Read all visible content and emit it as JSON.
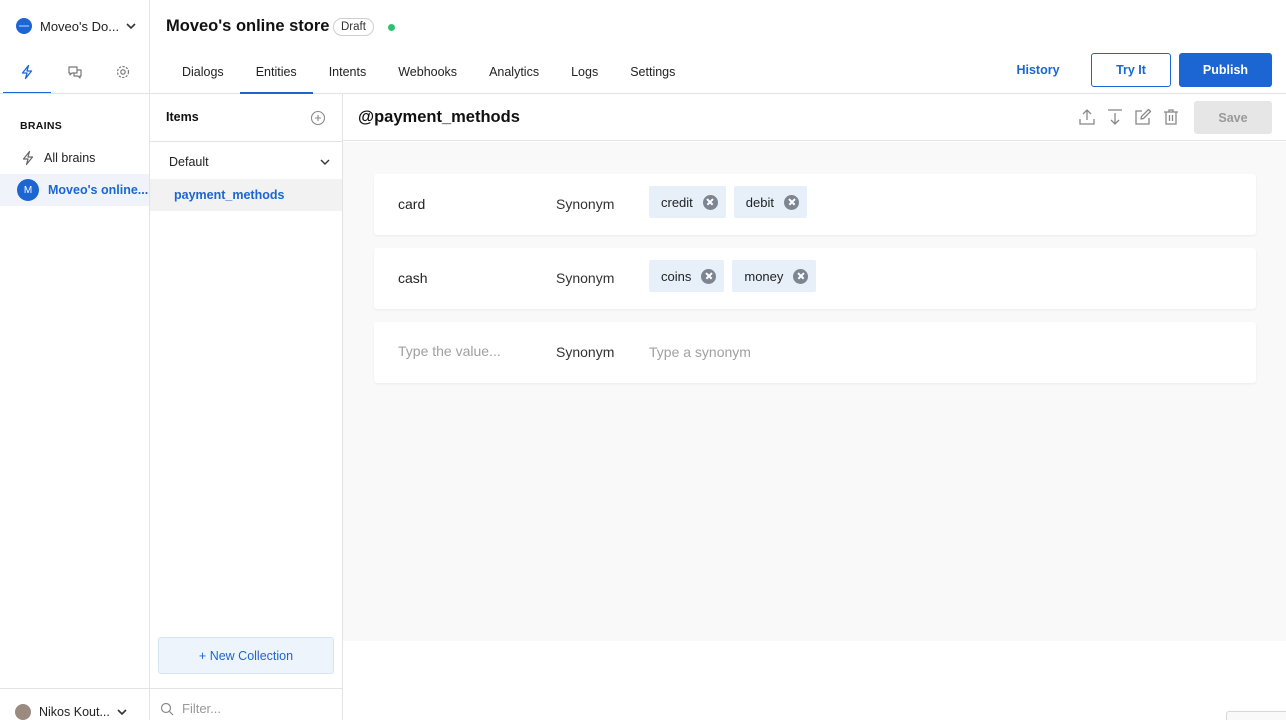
{
  "workspace": {
    "name": "Moveo's Do..."
  },
  "sidebar": {
    "tabs": [
      {
        "icon": "lightning-icon",
        "active": true
      },
      {
        "icon": "chat-bubbles-icon",
        "active": false
      },
      {
        "icon": "gear-icon",
        "active": false
      }
    ],
    "section_title": "BRAINS",
    "all_brains_label": "All brains",
    "active_brain": {
      "avatar_letter": "M",
      "label": "Moveo's online..."
    },
    "user_name": "Nikos Kout..."
  },
  "header": {
    "title": "Moveo's online store",
    "status_badge": "Draft",
    "status_color": "#2fc26e",
    "nav": [
      "Dialogs",
      "Entities",
      "Intents",
      "Webhooks",
      "Analytics",
      "Logs",
      "Settings"
    ],
    "active_nav": "Entities",
    "history_label": "History",
    "try_it_label": "Try It",
    "publish_label": "Publish"
  },
  "items_panel": {
    "title": "Items",
    "collection_name": "Default",
    "entities": [
      "payment_methods"
    ],
    "new_collection_label": "+ New Collection",
    "filter_placeholder": "Filter..."
  },
  "entity": {
    "title": "@payment_methods",
    "toolbar_icons": [
      "upload-icon",
      "download-icon",
      "edit-icon",
      "trash-icon"
    ],
    "save_label": "Save",
    "values": [
      {
        "name": "card",
        "type_label": "Synonym",
        "synonyms": [
          "credit",
          "debit"
        ]
      },
      {
        "name": "cash",
        "type_label": "Synonym",
        "synonyms": [
          "coins",
          "money"
        ]
      }
    ],
    "new_value": {
      "value_placeholder": "Type the value...",
      "type_label": "Synonym",
      "synonym_placeholder": "Type a synonym"
    }
  },
  "colors": {
    "accent": "#1b66d2",
    "chip_bg": "#e7f0f9",
    "canvas_bg": "#f9f9f9"
  }
}
